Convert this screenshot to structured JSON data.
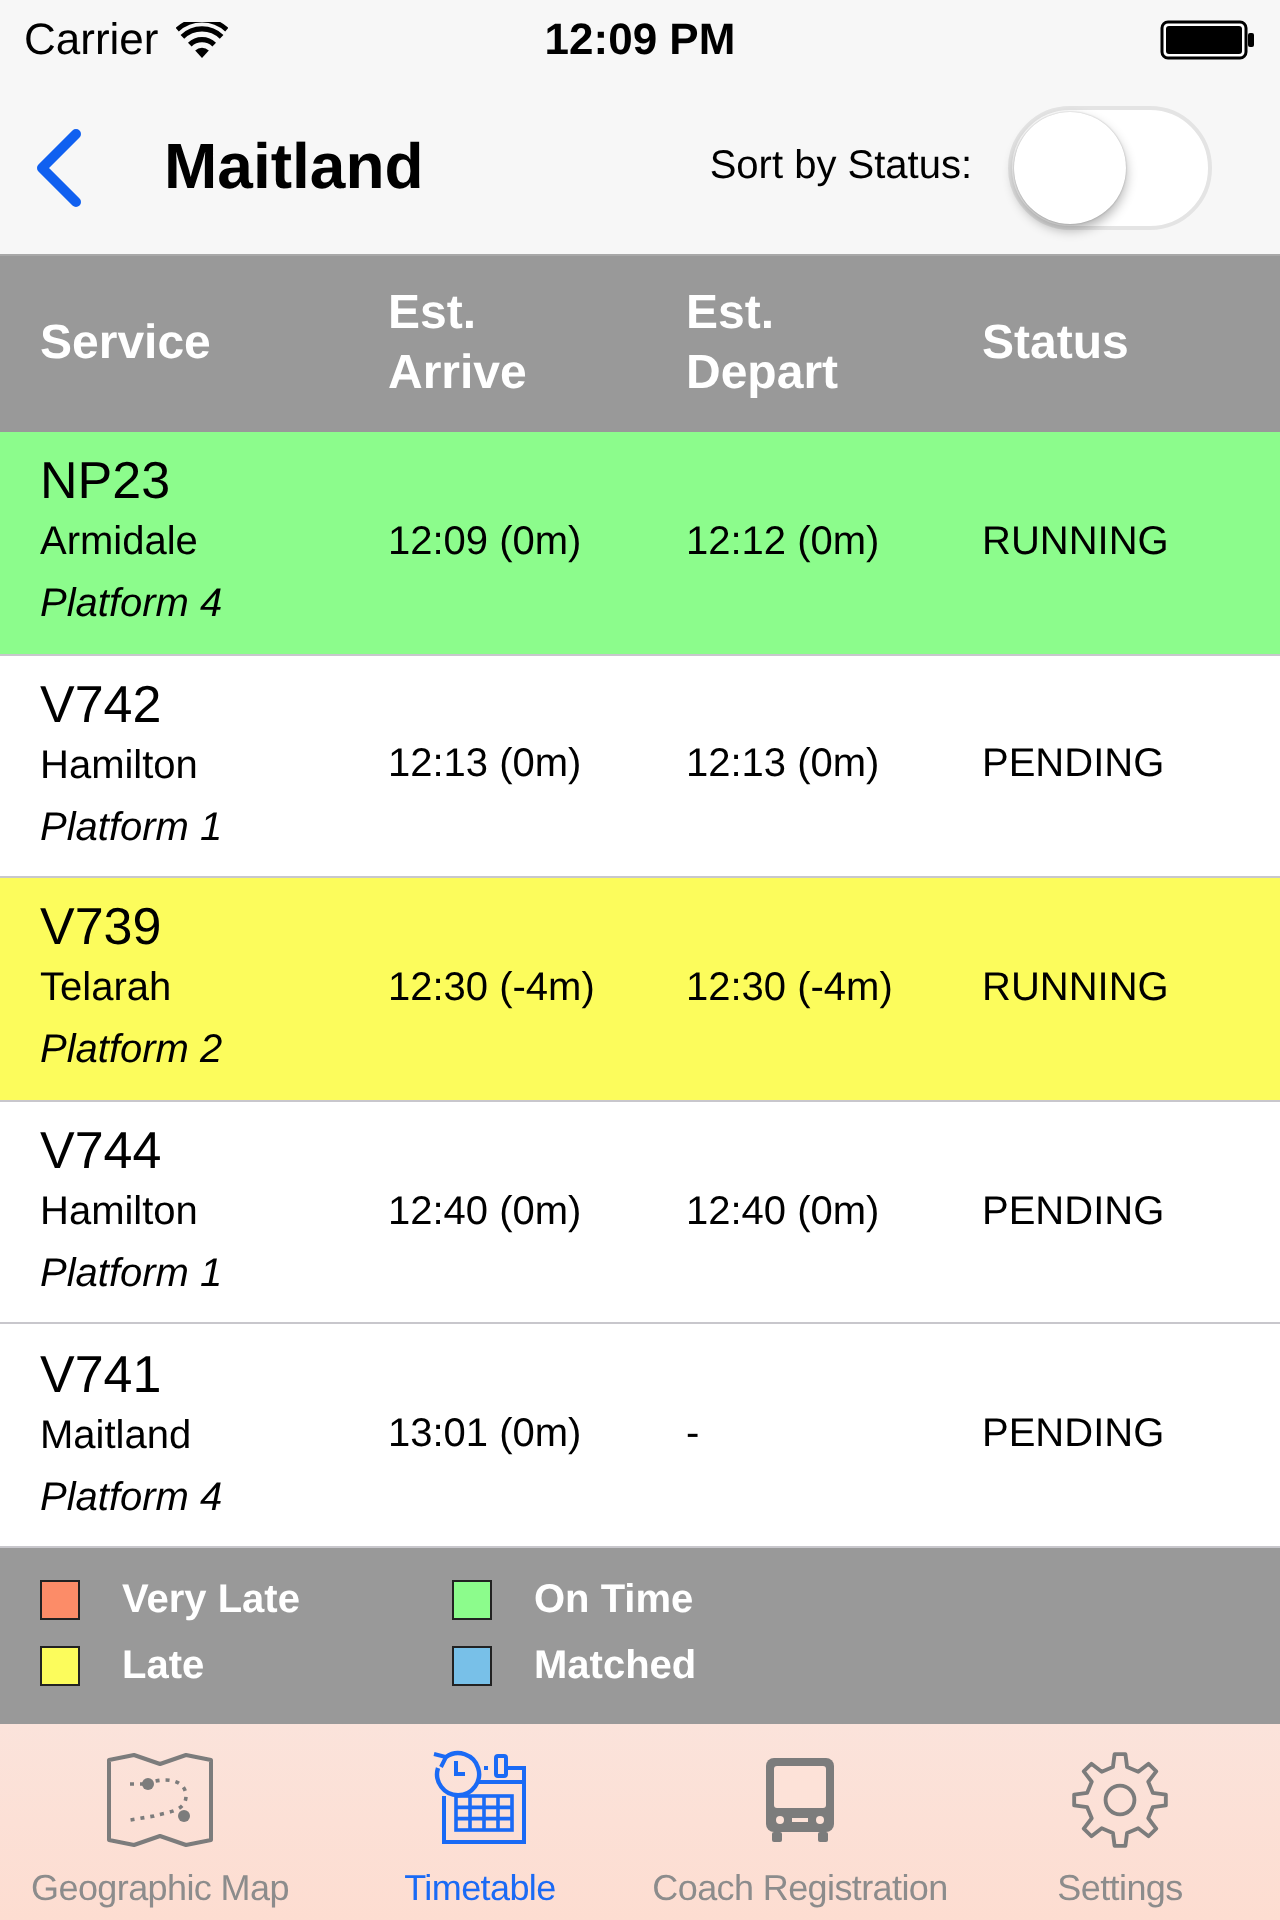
{
  "status_bar": {
    "carrier": "Carrier",
    "time": "12:09 PM"
  },
  "nav_bar": {
    "title": "Maitland",
    "sort_label": "Sort by Status:",
    "sort_toggle": {
      "on": false
    }
  },
  "table": {
    "columns": [
      "Service",
      "Est. Arrive",
      "Est. Depart",
      "Status"
    ],
    "rows": [
      {
        "service": "NP23",
        "origin": "Armidale",
        "platform": "Platform 4",
        "arrive": "12:09 (0m)",
        "depart": "12:12 (0m)",
        "status": "RUNNING",
        "color": "#8cfc8c"
      },
      {
        "service": "V742",
        "origin": "Hamilton",
        "platform": "Platform 1",
        "arrive": "12:13 (0m)",
        "depart": "12:13 (0m)",
        "status": "PENDING",
        "color": "#ffffff"
      },
      {
        "service": "V739",
        "origin": "Telarah",
        "platform": "Platform 2",
        "arrive": "12:30 (-4m)",
        "depart": "12:30 (-4m)",
        "status": "RUNNING",
        "color": "#fcfc5c"
      },
      {
        "service": "V744",
        "origin": "Hamilton",
        "platform": "Platform 1",
        "arrive": "12:40 (0m)",
        "depart": "12:40 (0m)",
        "status": "PENDING",
        "color": "#ffffff"
      },
      {
        "service": "V741",
        "origin": "Maitland",
        "platform": "Platform 4",
        "arrive": "13:01 (0m)",
        "depart": "-",
        "status": "PENDING",
        "color": "#ffffff"
      }
    ]
  },
  "legend": [
    {
      "label": "Very Late",
      "color": "#fc8c68"
    },
    {
      "label": "On Time",
      "color": "#8cfc8c"
    },
    {
      "label": "Late",
      "color": "#fcfc5c"
    },
    {
      "label": "Matched",
      "color": "#78c0e8"
    }
  ],
  "tabs": [
    {
      "label": "Geographic Map",
      "kind": "map",
      "selected": false
    },
    {
      "label": "Timetable",
      "kind": "timetable",
      "selected": true
    },
    {
      "label": "Coach Registration",
      "kind": "coach",
      "selected": false
    },
    {
      "label": "Settings",
      "kind": "settings",
      "selected": false
    }
  ]
}
